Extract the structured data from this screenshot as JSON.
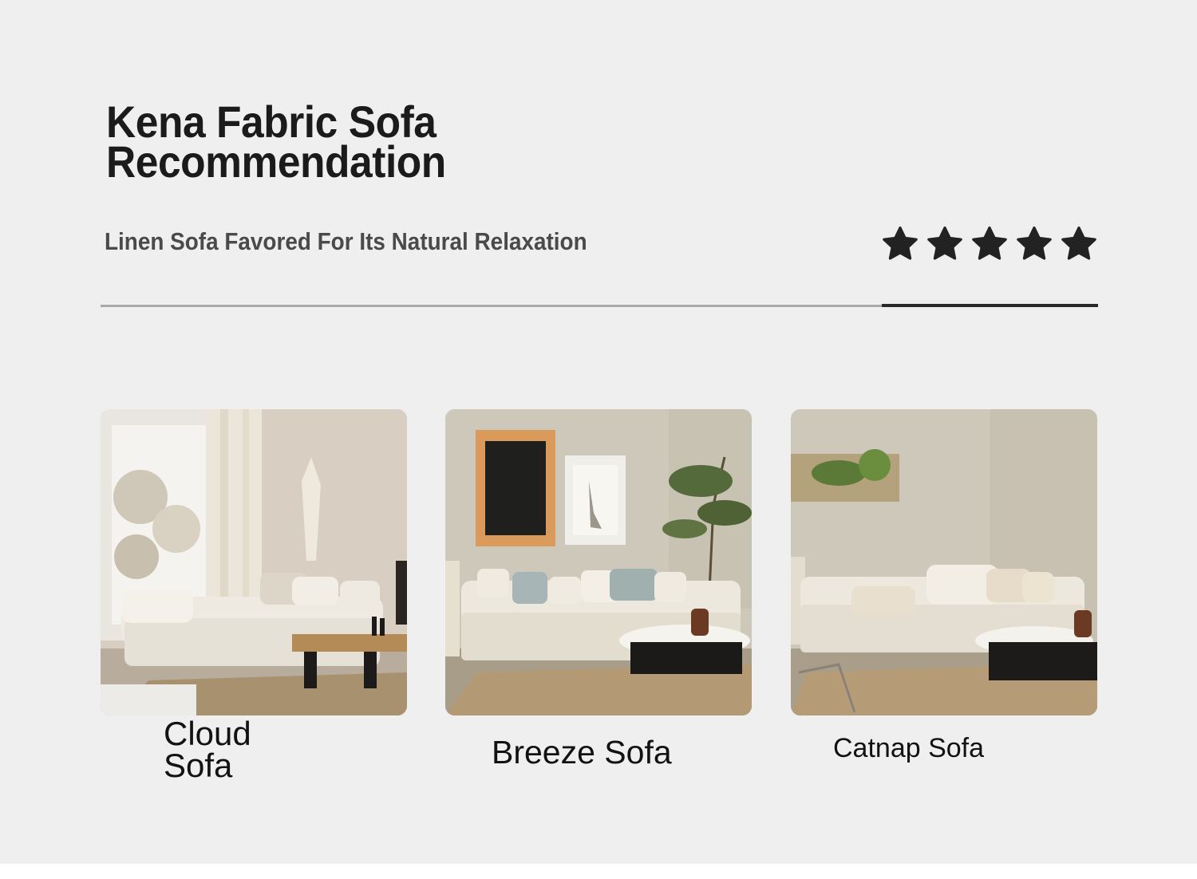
{
  "header": {
    "title_line1": "Kena Fabric Sofa",
    "title_line2": "Recommendation",
    "subtitle": "Linen Sofa Favored For Its Natural Relaxation",
    "rating_stars": 5
  },
  "products": [
    {
      "name": "Cloud Sofa",
      "name_line1": "Cloud",
      "name_line2": "Sofa"
    },
    {
      "name": "Breeze Sofa"
    },
    {
      "name": "Catnap Sofa"
    }
  ],
  "colors": {
    "background": "#efefef",
    "title": "#1b1b1b",
    "subtitle": "#4a4a4a",
    "star": "#222222",
    "divider": "#a9a9a9",
    "divider_accent": "#2a2a2a"
  }
}
